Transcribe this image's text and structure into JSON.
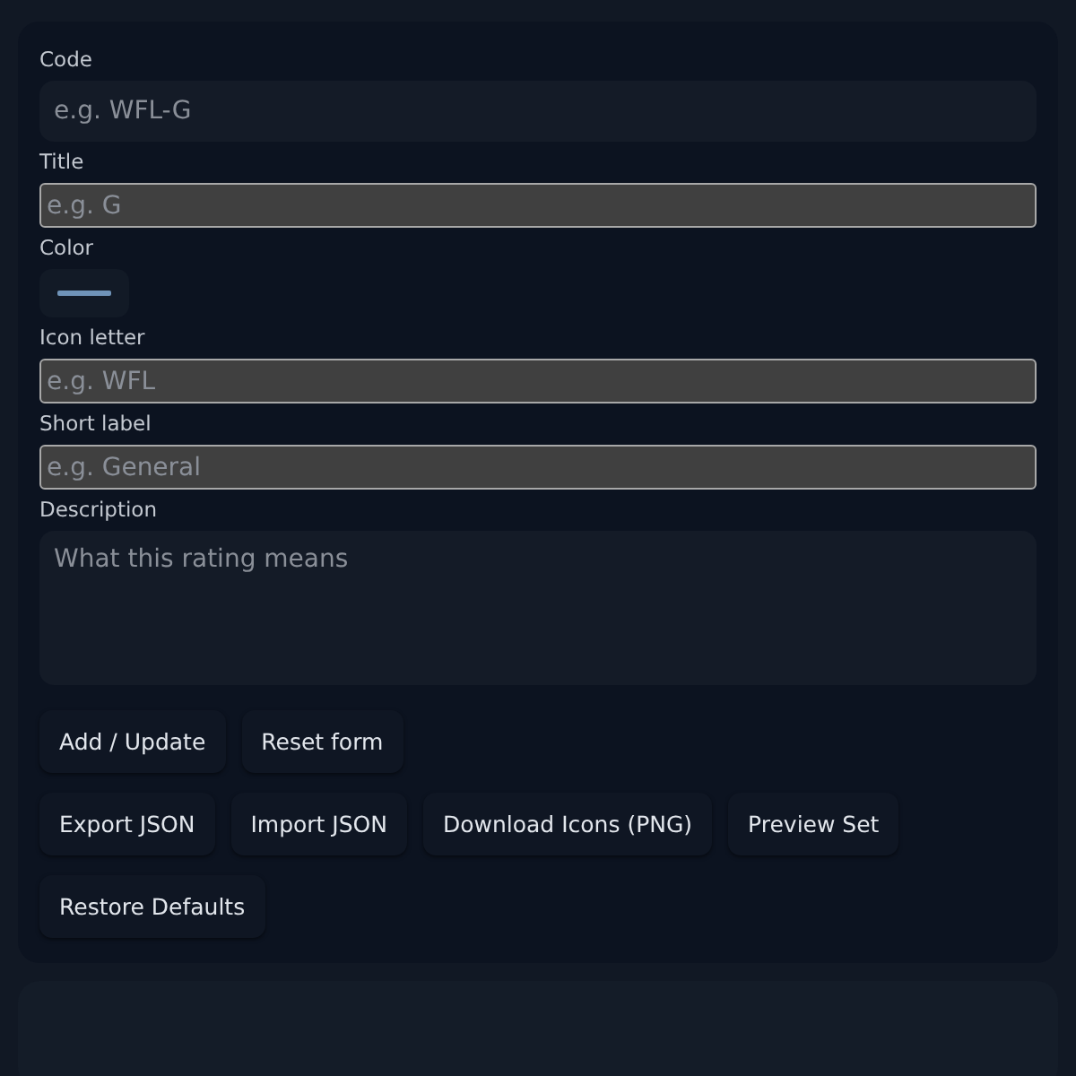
{
  "form": {
    "fields": [
      {
        "label": "Code",
        "kind": "plain",
        "placeholder": "e.g. WFL-G"
      },
      {
        "label": "Title",
        "kind": "boxed",
        "placeholder": "e.g. G"
      },
      {
        "label": "Color",
        "kind": "swatch",
        "color": "#6f93b8"
      },
      {
        "label": "Icon letter",
        "kind": "boxed",
        "placeholder": "e.g. WFL"
      },
      {
        "label": "Short label",
        "kind": "boxed",
        "placeholder": "e.g. General"
      },
      {
        "label": "Description",
        "kind": "area",
        "placeholder": "What this rating means"
      }
    ],
    "button_rows": [
      [
        "Add / Update",
        "Reset form"
      ],
      [
        "Export JSON",
        "Import JSON",
        "Download Icons (PNG)",
        "Preview Set"
      ],
      [
        "Restore Defaults"
      ]
    ]
  }
}
